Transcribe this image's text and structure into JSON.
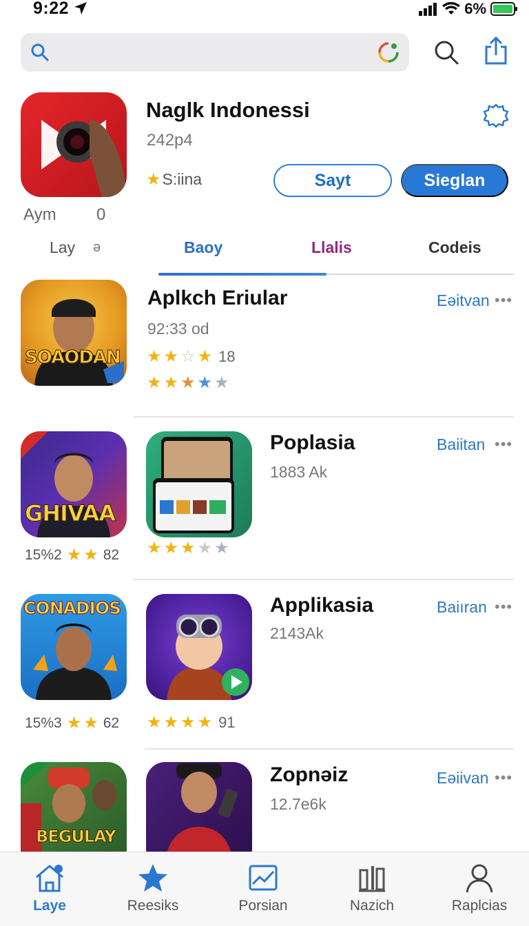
{
  "status_bar": {
    "time": "9:22",
    "battery": "6%"
  },
  "search": {
    "placeholder": ""
  },
  "featured": {
    "title": "Naglk Indonessi",
    "subtitle": "242p4",
    "rating_text": "S:iina",
    "button_outline": "Sayt",
    "button_primary": "Sieglan",
    "meta_left": "Aym",
    "meta_right": "0"
  },
  "tabs": {
    "left_label": "Lay",
    "left_extra": "ə",
    "items": [
      "Baoy",
      "Llalis",
      "Codeis"
    ],
    "active_index": 0
  },
  "list": [
    {
      "title": "Aplkch Eriular",
      "subtitle": "92:33 od",
      "action": "Eəitvan",
      "more": "•••",
      "rating1_count": "18",
      "icon_text": "SOAODAN"
    },
    {
      "title": "Poplasia",
      "subtitle": "1883 Ak",
      "action": "Baiitan",
      "more": "•••",
      "left_icon_text": "GHIVAA",
      "left_caption_a": "15%2",
      "left_caption_b": "82"
    },
    {
      "title": "Applikasia",
      "subtitle": "2143Ak",
      "action": "Baiıran",
      "more": "•••",
      "left_icon_text": "CONADIOS",
      "left_caption_a": "15%3",
      "left_caption_b": "62",
      "rating_count": "91"
    },
    {
      "title": "Zopnəiz",
      "subtitle": "12.7e6k",
      "action": "Eəiivan",
      "more": "•••",
      "left_icon_text": "BEGULAY"
    }
  ],
  "tabbar": {
    "items": [
      "Laye",
      "Reesiks",
      "Porsian",
      "Nazich",
      "Raplcias"
    ],
    "active_index": 0
  },
  "colors": {
    "accent": "#2878d6",
    "star": "#f3b212",
    "tab_purple": "#8e2a7a"
  }
}
